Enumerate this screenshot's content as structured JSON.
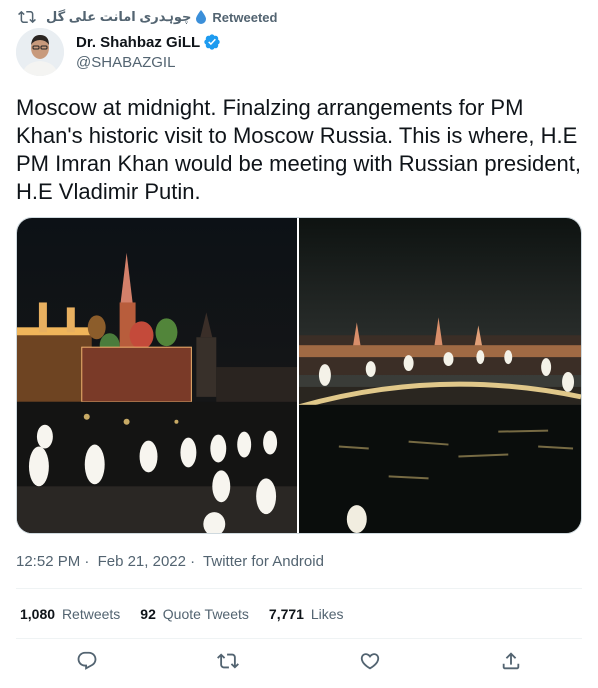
{
  "retweet": {
    "retweeter_name": "چوہدری امانت علی گل",
    "label": "Retweeted"
  },
  "author": {
    "name": "Dr. Shahbaz GiLL",
    "handle": "@SHABAZGIL",
    "verified": true
  },
  "tweet": {
    "text": "Moscow at midnight. Finalzing arrangements for PM Khan's historic visit to Moscow Russia.  This is where, H.E PM Imran Khan would be meeting with Russian president, H.E Vladimir Putin.",
    "time": "12:52 PM",
    "date": "Feb 21, 2022",
    "source": "Twitter for Android",
    "separator": "·"
  },
  "stats": {
    "retweets_count": "1,080",
    "retweets_label": "Retweets",
    "quotes_count": "92",
    "quotes_label": "Quote Tweets",
    "likes_count": "7,771",
    "likes_label": "Likes"
  },
  "actions": [
    "reply-icon",
    "retweet-icon",
    "like-icon",
    "share-icon"
  ],
  "colors": {
    "text_primary": "#0f1419",
    "text_secondary": "#536471",
    "verified": "#1d9bf0",
    "divider": "#eff3f4"
  }
}
